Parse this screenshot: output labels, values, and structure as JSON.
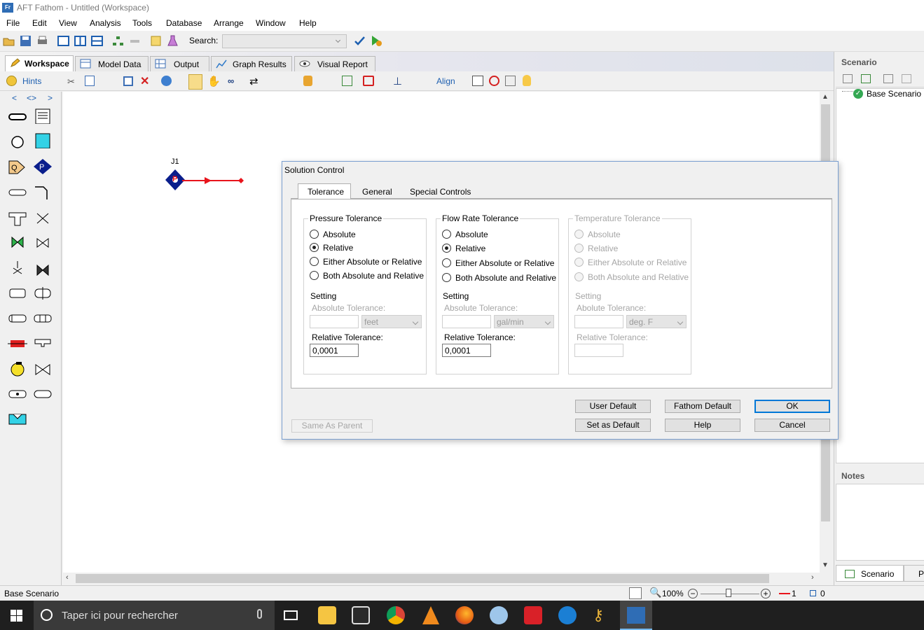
{
  "window": {
    "title": "AFT Fathom - Untitled (Workspace)",
    "app_icon": "Fr"
  },
  "menu": [
    "File",
    "Edit",
    "View",
    "Analysis",
    "Tools",
    "Database",
    "Arrange",
    "Window",
    "Help"
  ],
  "toolbar": {
    "search_label": "Search:",
    "search_value": ""
  },
  "tabs": [
    "Workspace",
    "Model Data",
    "Output",
    "Graph Results",
    "Visual Report"
  ],
  "toolbar2": {
    "hints_label": "Hints",
    "align_label": "Align"
  },
  "palette": {
    "nav": [
      "<",
      "<>",
      ">"
    ]
  },
  "canvas": {
    "junction_label": "J1",
    "junction_glyph": "P"
  },
  "scenario_panel": {
    "title": "Scenario",
    "item": "Base Scenario"
  },
  "notes_panel": {
    "title": "Notes"
  },
  "panel_tabs": [
    "Scenario",
    "P"
  ],
  "status": {
    "scenario": "Base Scenario",
    "zoom": "100%",
    "pipes": "1",
    "junctions": "0"
  },
  "taskbar": {
    "search_placeholder": "Taper ici pour rechercher"
  },
  "dialog": {
    "title": "Solution Control",
    "tabs": [
      "Tolerance",
      "General",
      "Special Controls"
    ],
    "options": [
      "Absolute",
      "Relative",
      "Either Absolute or Relative",
      "Both Absolute and Relative"
    ],
    "groups": [
      {
        "title": "Pressure Tolerance",
        "selected": 1,
        "enabled": true,
        "setting": "Setting",
        "abs_label": "Absolute Tolerance:",
        "abs_value": "",
        "unit": "feet",
        "rel_label": "Relative Tolerance:",
        "rel_value": "0,0001"
      },
      {
        "title": "Flow Rate Tolerance",
        "selected": 1,
        "enabled": true,
        "setting": "Setting",
        "abs_label": "Absolute Tolerance:",
        "abs_value": "",
        "unit": "gal/min",
        "rel_label": "Relative Tolerance:",
        "rel_value": "0,0001"
      },
      {
        "title": "Temperature Tolerance",
        "selected": -1,
        "enabled": false,
        "setting": "Setting",
        "abs_label": "Abolute Tolerance:",
        "abs_value": "",
        "unit": "deg. F",
        "rel_label": "Relative Tolerance:",
        "rel_value": ""
      }
    ],
    "buttons": {
      "same_as_parent": "Same As Parent",
      "user_default": "User Default",
      "fathom_default": "Fathom Default",
      "ok": "OK",
      "set_as_default": "Set as Default",
      "help": "Help",
      "cancel": "Cancel"
    }
  },
  "colors": {
    "accent": "#0078d7",
    "junction_fill": "#0a1e8c",
    "pipe": "#e8141c",
    "taskbar": "#1f1f1f"
  }
}
